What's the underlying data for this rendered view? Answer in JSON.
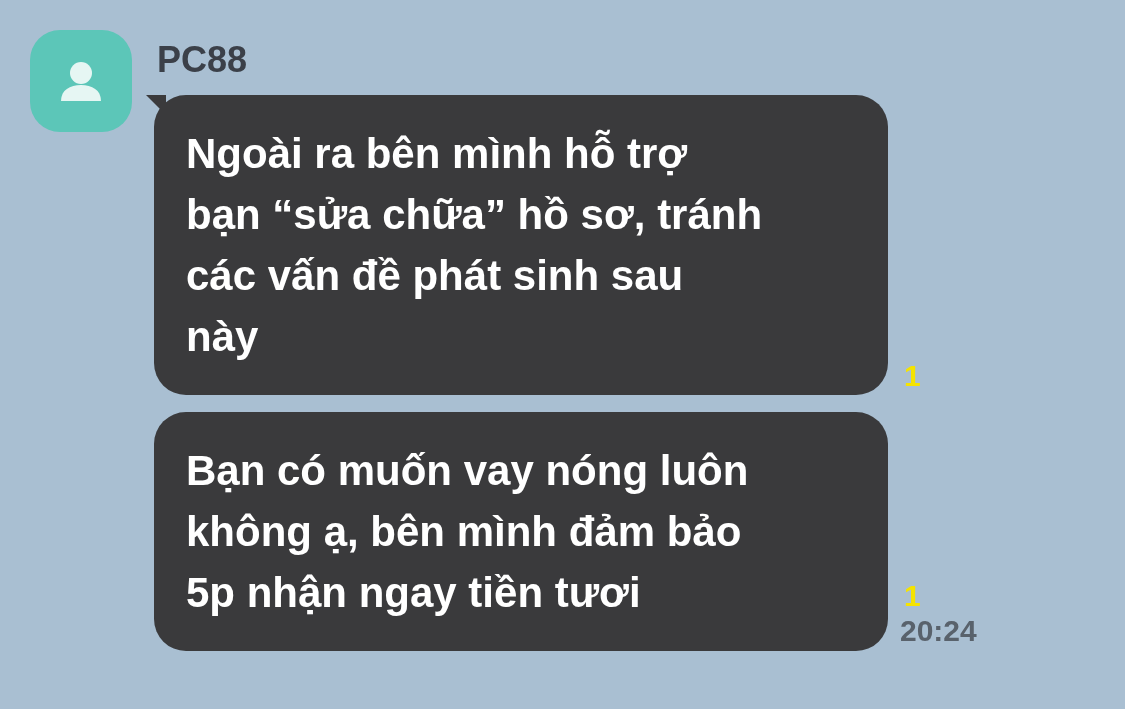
{
  "sender": {
    "name": "PC88"
  },
  "messages": [
    {
      "lines": [
        "Ngoài ra bên mình hỗ trợ",
        "bạn “sửa chữa” hồ sơ, tránh",
        "các vấn đề phát sinh sau",
        "này"
      ],
      "read_count": "1"
    },
    {
      "lines": [
        "Bạn có muốn vay nóng luôn",
        "không ạ, bên mình đảm bảo",
        "5p nhận ngay tiền tươi"
      ],
      "read_count": "1",
      "time": "20:24"
    }
  ]
}
